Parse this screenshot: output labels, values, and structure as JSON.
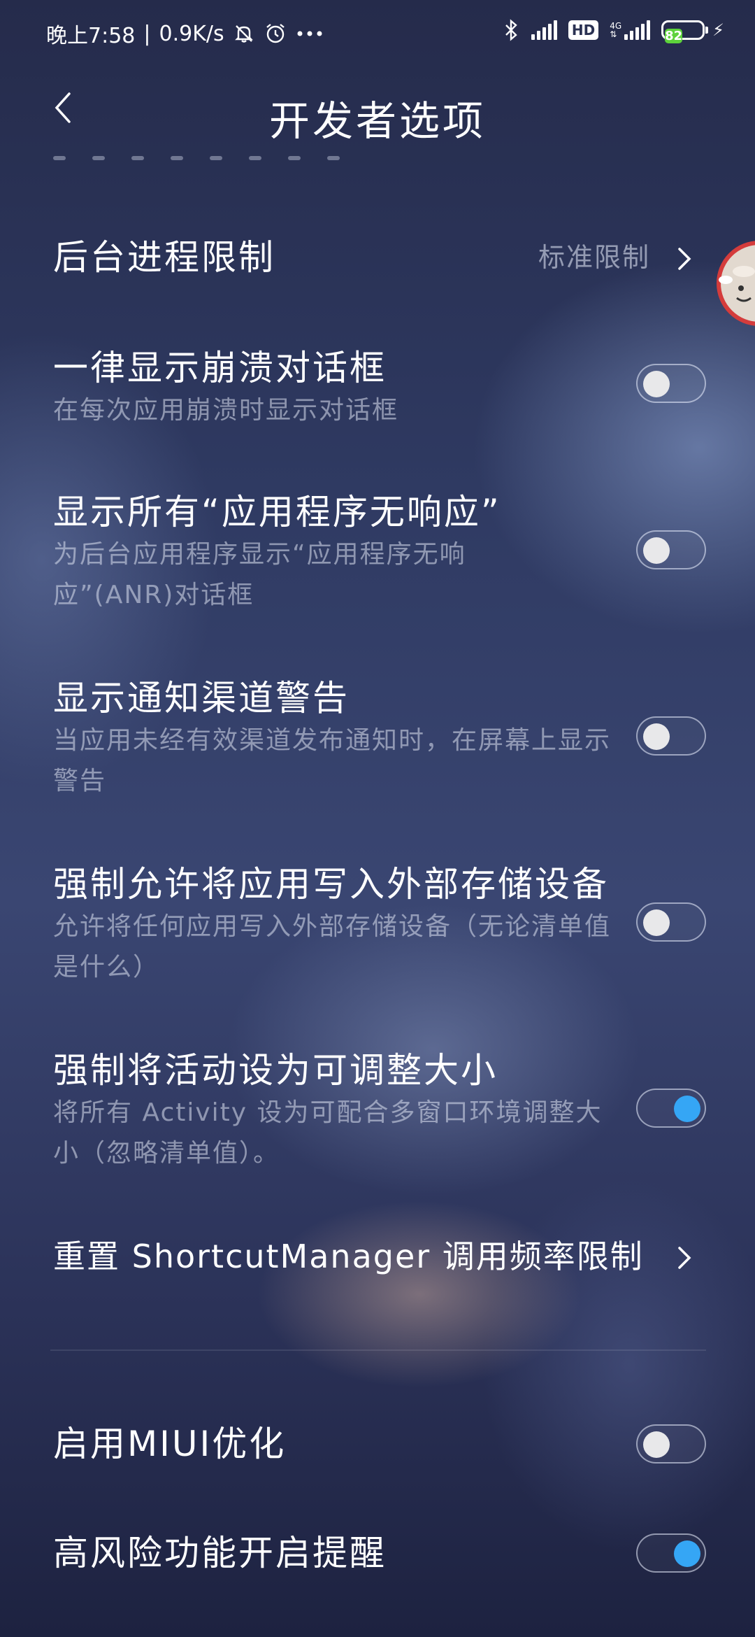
{
  "status_bar": {
    "time": "晚上7:58",
    "speed": "0.9K/s",
    "network_label": "4G",
    "hd_label": "HD",
    "battery_level": "82",
    "battery_color": "#5dd23b"
  },
  "header": {
    "title": "开发者选项"
  },
  "settings": {
    "background_process_limit": {
      "title": "后台进程限制",
      "value": "标准限制"
    },
    "show_crash_dialog": {
      "title": "一律显示崩溃对话框",
      "summary": "在每次应用崩溃时显示对话框",
      "enabled": false
    },
    "show_all_anr": {
      "title": "显示所有“应用程序无响应”",
      "summary": "为后台应用程序显示“应用程序无响应”(ANR)对话框",
      "enabled": false
    },
    "notification_channel_warning": {
      "title": "显示通知渠道警告",
      "summary": "当应用未经有效渠道发布通知时，在屏幕上显示警告",
      "enabled": false
    },
    "force_external_storage": {
      "title": "强制允许将应用写入外部存储设备",
      "summary": "允许将任何应用写入外部存储设备（无论清单值是什么）",
      "enabled": false
    },
    "force_resizable": {
      "title": "强制将活动设为可调整大小",
      "summary": "将所有 Activity 设为可配合多窗口环境调整大小（忽略清单值）。",
      "enabled": true
    },
    "reset_shortcut_manager": {
      "title": "重置 ShortcutManager 调用频率限制"
    },
    "enable_miui_optimization": {
      "title": "启用MIUI优化",
      "enabled": false
    },
    "high_risk_reminder": {
      "title": "高风险功能开启提醒",
      "enabled": true
    }
  },
  "colors": {
    "toggle_on": "#35a6f5",
    "toggle_off_knob": "#e8e8ea",
    "background": "#2f3a62"
  }
}
